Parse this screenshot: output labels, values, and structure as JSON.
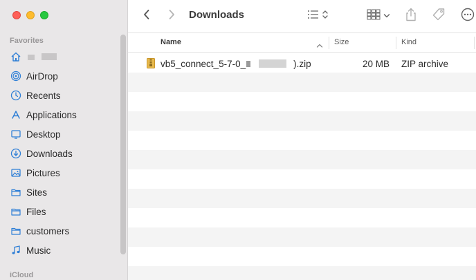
{
  "sidebar": {
    "favorites_label": "Favorites",
    "icloud_label": "iCloud",
    "items": [
      {
        "label": "",
        "icon": "home-icon"
      },
      {
        "label": "AirDrop",
        "icon": "airdrop-icon"
      },
      {
        "label": "Recents",
        "icon": "clock-icon"
      },
      {
        "label": "Applications",
        "icon": "applications-icon"
      },
      {
        "label": "Desktop",
        "icon": "desktop-icon"
      },
      {
        "label": "Downloads",
        "icon": "download-icon"
      },
      {
        "label": "Pictures",
        "icon": "pictures-icon"
      },
      {
        "label": "Sites",
        "icon": "folder-icon"
      },
      {
        "label": "Files",
        "icon": "folder-icon"
      },
      {
        "label": "customers",
        "icon": "folder-icon"
      },
      {
        "label": "Music",
        "icon": "music-icon"
      }
    ]
  },
  "toolbar": {
    "title": "Downloads"
  },
  "list": {
    "columns": {
      "name": "Name",
      "size": "Size",
      "kind": "Kind"
    },
    "files": [
      {
        "name_prefix": "vb5_connect_5-7-0_",
        "name_suffix": ").zip",
        "size": "20 MB",
        "kind": "ZIP archive",
        "icon": "zip-archive-icon"
      }
    ]
  },
  "colors": {
    "sidebar_bg": "#e9e7e8",
    "accent_icon": "#2f7fd6",
    "row_alt": "#f4f4f4"
  }
}
